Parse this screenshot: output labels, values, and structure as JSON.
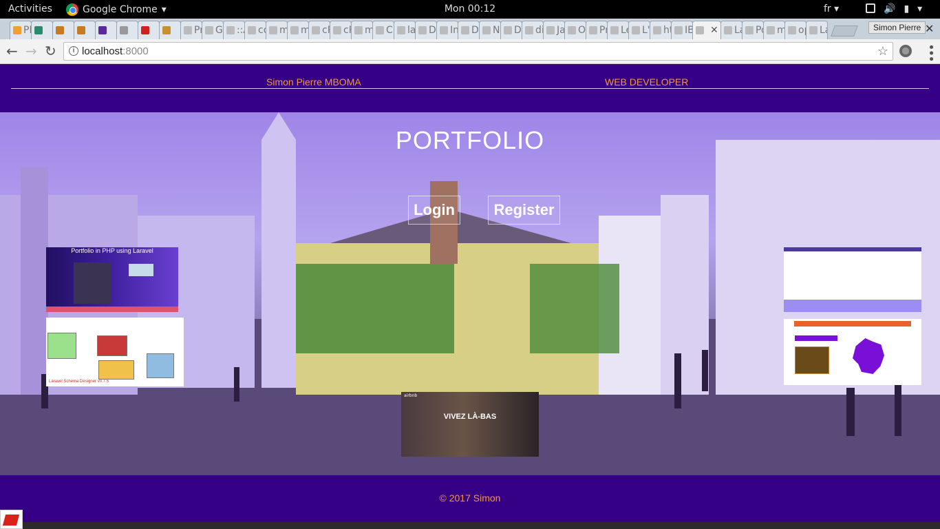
{
  "desktop": {
    "activities": "Activities",
    "app_name": "Google Chrome",
    "clock": "Mon 00:12",
    "language": "fr"
  },
  "browser": {
    "tabs": [
      "PMA",
      "",
      "",
      "",
      "",
      "",
      "",
      "",
      "Pr",
      "Gr",
      "::A",
      "co",
      "m",
      "m",
      "cP",
      "cP",
      "m",
      "Cr",
      "la",
      "De",
      "In",
      "De",
      "Ne",
      "De",
      "dif",
      "Ja",
      "Ou",
      "Pr",
      "Le",
      "L'I",
      "ht",
      "IB",
      "",
      "La",
      "Po",
      "m",
      "op",
      "La"
    ],
    "active_tab_index": 32,
    "profile": "Simon Pierre",
    "url_host": "localhost",
    "url_port": ":8000"
  },
  "site": {
    "header": {
      "name": "Simon Pierre MBOMA",
      "role": "WEB DEVELOPER"
    },
    "hero": {
      "title": "PORTFOLIO",
      "login": "Login",
      "register": "Register"
    },
    "projects": {
      "laravel_portfolio_caption": "Portfolio in PHP using Laravel",
      "laravel_schema_caption": "Laravel Schema Designer v0.7.5",
      "airbnb_caption": "VIVEZ LÀ-BAS",
      "airbnb_brand": "airbnb"
    },
    "footer": {
      "copyright": "© 2017 Simon"
    }
  },
  "colors": {
    "brand": "#350086",
    "accent": "#f39a2a"
  }
}
